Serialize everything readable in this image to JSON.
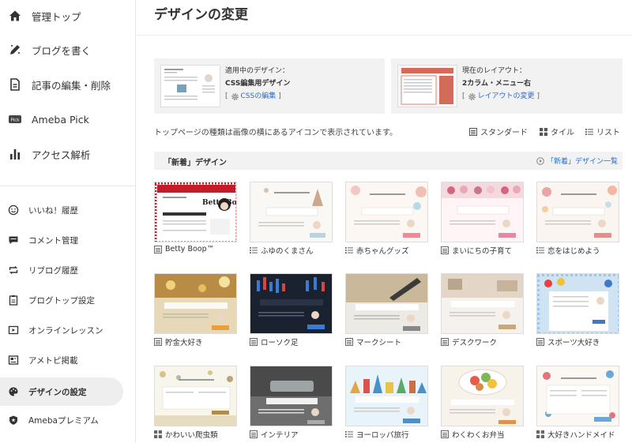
{
  "sidebar": {
    "main_items": [
      {
        "label": "管理トップ",
        "icon": "home-icon"
      },
      {
        "label": "ブログを書く",
        "icon": "pen-icon"
      },
      {
        "label": "記事の編集・削除",
        "icon": "document-icon"
      },
      {
        "label": "Ameba Pick",
        "icon": "pick-icon"
      },
      {
        "label": "アクセス解析",
        "icon": "bar-chart-icon"
      }
    ],
    "sub_items": [
      {
        "label": "いいね！履歴",
        "icon": "smile-icon"
      },
      {
        "label": "コメント管理",
        "icon": "comment-icon"
      },
      {
        "label": "リブログ履歴",
        "icon": "reblog-icon"
      },
      {
        "label": "ブログトップ設定",
        "icon": "clipboard-icon"
      },
      {
        "label": "オンラインレッスン",
        "icon": "video-icon"
      },
      {
        "label": "アメトピ掲載",
        "icon": "newspaper-icon"
      },
      {
        "label": "デザインの設定",
        "icon": "palette-icon",
        "active": true
      },
      {
        "label": "Amebaプレミアム",
        "icon": "shield-icon"
      }
    ],
    "pick_badge": "Pick"
  },
  "main": {
    "title": "デザインの変更",
    "current_design": {
      "label": "適用中のデザイン：",
      "value": "CSS編集用デザイン",
      "link": "CSSの編集"
    },
    "current_layout": {
      "label": "現在のレイアウト：",
      "value": "2カラム・メニュー右",
      "link": "レイアウトの変更"
    },
    "bracket_open": "[",
    "bracket_close": "]",
    "hint": "トップページの種類は画像の横にあるアイコンで表示されています。",
    "views": {
      "standard": "スタンダード",
      "tile": "タイル",
      "list": "リスト"
    },
    "section": {
      "title": "「新着」デザイン",
      "link": "「新着」デザイン一覧"
    },
    "designs": [
      {
        "name": "Betty Boop™",
        "type": "standard"
      },
      {
        "name": "ふゆのくまさん",
        "type": "list"
      },
      {
        "name": "赤ちゃんグッズ",
        "type": "list"
      },
      {
        "name": "まいにちの子育て",
        "type": "standard"
      },
      {
        "name": "恋をはじめよう",
        "type": "list"
      },
      {
        "name": "貯金大好き",
        "type": "standard"
      },
      {
        "name": "ローソク足",
        "type": "standard"
      },
      {
        "name": "マークシート",
        "type": "standard"
      },
      {
        "name": "デスクワーク",
        "type": "standard"
      },
      {
        "name": "スポーツ大好き",
        "type": "standard"
      },
      {
        "name": "かわいい爬虫類",
        "type": "tile"
      },
      {
        "name": "インテリア",
        "type": "standard"
      },
      {
        "name": "ヨーロッパ旅行",
        "type": "list"
      },
      {
        "name": "わくわくお弁当",
        "type": "standard"
      },
      {
        "name": "大好きハンドメイド",
        "type": "tile"
      }
    ],
    "betty_thumb_text": "Betty Boop"
  },
  "colors": {
    "accent_link": "#2a6bc9",
    "panel_bg": "#f2f2f2",
    "active_bg": "#eeeeee"
  }
}
